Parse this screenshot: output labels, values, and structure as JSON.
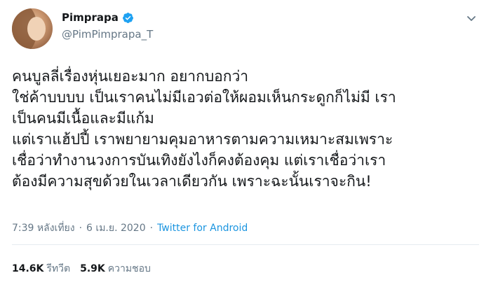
{
  "user": {
    "display_name": "Pimprapa",
    "handle": "@PimPimprapa_T",
    "verified": true
  },
  "icons": {
    "verified": "verified-badge-icon",
    "caret": "chevron-down-icon"
  },
  "colors": {
    "accent": "#1da1f2",
    "link": "#1b95e0",
    "secondary_text": "#657786"
  },
  "tweet": {
    "lines": [
      "คนบูลลี่เรื่องหุ่นเยอะมาก อยากบอกว่า",
      "ใช่ค้าบบบบ เป็นเราคนไม่มีเอวต่อให้ผอมเห็นกระดูกก็ไม่มี เรา",
      "เป็นคนมีเนื้อและมีแก้ม",
      "แต่เราแฮ้ปปี้ เราพยายามคุมอาหารตามความเหมาะสมเพราะ",
      "เชื่อว่าทำงานวงการบันเทิงยังไงก็คงต้องคุม แต่เราเชื่อว่าเรา",
      "ต้องมีความสุขด้วยในเวลาเดียวกัน เพราะฉะนั้นเราจะกิน!"
    ]
  },
  "meta": {
    "time": "7:39 หลังเที่ยง",
    "sep1": "·",
    "date": "6 เม.ย. 2020",
    "sep2": "·",
    "source": "Twitter for Android"
  },
  "stats": {
    "retweets_count": "14.6K",
    "retweets_label": "รีทวีต",
    "likes_count": "5.9K",
    "likes_label": "ความชอบ"
  }
}
